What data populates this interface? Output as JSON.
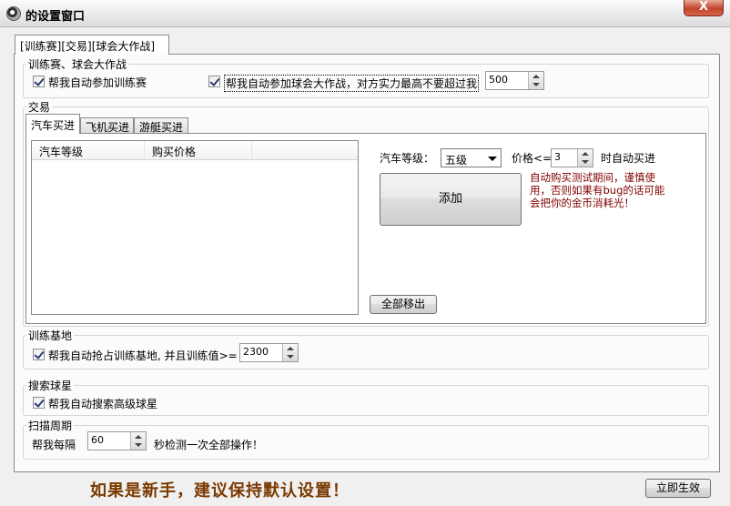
{
  "window": {
    "title": "的设置窗口",
    "close_label": "X"
  },
  "main_tab": {
    "label": "[训练赛][交易][球会大作战]"
  },
  "match": {
    "legend": "训练赛、球会大作战",
    "auto_training_label": "帮我自动参加训练赛",
    "auto_training_checked": true,
    "auto_battle_label": "帮我自动参加球会大作战，对方实力最高不要超过我",
    "auto_battle_checked": true,
    "battle_limit": "500"
  },
  "trade": {
    "legend": "交易",
    "tabs": [
      "汽车买进",
      "飞机买进",
      "游艇买进"
    ],
    "active_tab": 0,
    "list_columns": [
      "汽车等级",
      "购买价格"
    ],
    "level_label": "汽车等级：",
    "level_value": "五级",
    "price_label": "价格<=",
    "price_value": "3",
    "auto_buy_label": "时自动买进",
    "add_button": "添加",
    "remove_all_button": "全部移出",
    "warning": [
      "自动购买测试期间，谨慎使",
      "用，否则如果有bug的话可能",
      "会把你的金币消耗光！"
    ]
  },
  "base": {
    "legend": "训练基地",
    "label": "帮我自动抢占训练基地, 并且训练值>=",
    "checked": true,
    "value": "2300"
  },
  "search": {
    "legend": "搜索球星",
    "label": "帮我自动搜索高级球星",
    "checked": true
  },
  "scan": {
    "legend": "扫描周期",
    "prefix": "帮我每隔",
    "value": "60",
    "suffix": "秒检测一次全部操作！"
  },
  "footer": {
    "note": "如果是新手，建议保持默认设置！",
    "apply_button": "立即生效"
  }
}
